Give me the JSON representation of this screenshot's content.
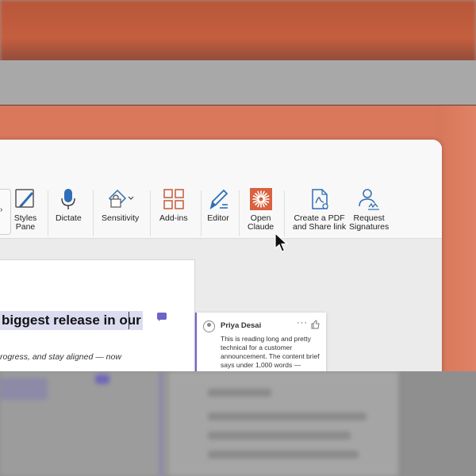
{
  "ribbon": {
    "items": [
      {
        "label_1": "Styles",
        "label_2": "Pane",
        "icon": "styles-pane-icon"
      },
      {
        "label_1": "Dictate",
        "label_2": "",
        "icon": "microphone-icon"
      },
      {
        "label_1": "Sensitivity",
        "label_2": "",
        "icon": "sensitivity-icon"
      },
      {
        "label_1": "Add-ins",
        "label_2": "",
        "icon": "add-ins-icon"
      },
      {
        "label_1": "Editor",
        "label_2": "",
        "icon": "editor-pen-icon"
      },
      {
        "label_1": "Open",
        "label_2": "Claude",
        "icon": "claude-icon"
      },
      {
        "label_1": "Create a PDF",
        "label_2": "and Share link",
        "icon": "pdf-share-icon"
      },
      {
        "label_1": "Request",
        "label_2": "Signatures",
        "icon": "request-signatures-icon"
      }
    ],
    "gallery_arrow": "›"
  },
  "document": {
    "headline": "biggest release in our",
    "subline": "rogress, and stay aligned — now"
  },
  "comment": {
    "author": "Priya Desai",
    "more": "···",
    "text": "This is reading long and pretty technical for a customer announcement. The content brief says under 1,000 words —"
  },
  "colors": {
    "accent": "#6c63c7",
    "claude_orange": "#d9613f",
    "icon_blue": "#2f6eb6",
    "backdrop": "#d9785a"
  }
}
